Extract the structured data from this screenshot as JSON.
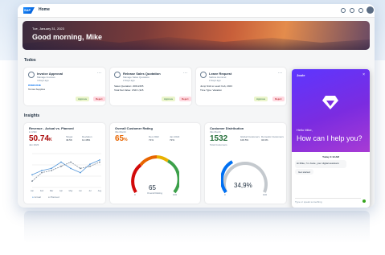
{
  "header": {
    "logo_text": "SAP",
    "title": "Home"
  },
  "hero": {
    "date": "Tue, January 31, 2023",
    "greeting": "Good morning, Mike"
  },
  "sections": {
    "todos": "Todos",
    "insights": "Insights"
  },
  "todos": [
    {
      "title": "Invoice Approval",
      "sub1": "Manage Invoices",
      "sub2": "4 days ago",
      "tag": "OVER-DUE",
      "line1": "Tomsa Supplies",
      "approve": "Approve",
      "reject": "Reject"
    },
    {
      "title": "Release Sales Quotation",
      "sub1": "Manage Sales Quotation",
      "sub2": "2 days ago",
      "line1": "Sales Quotation: 20012465",
      "line2": "Total Net Value: USD 1,915",
      "approve": "Approve",
      "reject": "Reject"
    },
    {
      "title": "Leave Request",
      "sub1": "Sabine Hummel",
      "sub2": "2 days ago",
      "line1": "Jump Sick to Lead: Feb, 2023",
      "line2": "Time Type: Vacation",
      "approve": "Approve",
      "reject": "Reject"
    }
  ],
  "insights": {
    "revenue": {
      "title": "Revenue - Actual vs. Planned",
      "sub": "in USD",
      "value": "50.74",
      "unit": "K",
      "target_label": "Target",
      "target": "49.5K",
      "deviation_label": "Deviation",
      "deviation": "12.48%",
      "period": "Jan 2023",
      "legend_actual": "Actual",
      "legend_planned": "Planned"
    },
    "rating": {
      "title": "Overall Customer Rating",
      "sub": "this Month",
      "value": "65",
      "unit": "%",
      "label1": "Dec 2022",
      "val1": "71%",
      "label2": "Jan 2022",
      "val2": "72%",
      "gauge_value": "65",
      "gauge_label": "Overall Rating",
      "gauge_min": "0",
      "gauge_max": "100",
      "level": 0.65
    },
    "distribution": {
      "title": "Customer Distribution",
      "sub": "this Month",
      "value": "1532",
      "unit": "",
      "label1": "Global Customers",
      "val1": "100.5%",
      "label2": "Domestic Customers",
      "val2": "34.9%",
      "period": "Total Customers",
      "donut_value": "34,9%",
      "level": 0.349,
      "gauge_min": "0",
      "gauge_max": "100"
    }
  },
  "chat": {
    "name": "Joule",
    "close": "×",
    "hello": "Hello Mike,",
    "help": "How can I help you?",
    "today": "Today 4:19 AM",
    "msg": "Hi Mike, I'm Joule, your digital assistant.",
    "bubble": "Get started",
    "input_placeholder": "Type or speak something"
  },
  "colors": {
    "accent": "#0070f2",
    "chat_top": "#5d36ff",
    "chat_bottom": "#a83bd4",
    "approve": "#256f3a",
    "reject": "#aa0808",
    "kpi_green": "#256f3a",
    "kpi_orange": "#e76500"
  },
  "chart_data": [
    {
      "type": "line",
      "x": [
        "Jan",
        "Feb",
        "Mar",
        "Apr",
        "May",
        "Jun",
        "Jul",
        "Aug"
      ],
      "series": [
        {
          "name": "Actual",
          "values": [
            38,
            40,
            41,
            44,
            41,
            39,
            43,
            45
          ]
        },
        {
          "name": "Planned",
          "values": [
            35,
            39,
            40,
            42,
            44,
            41,
            42,
            44
          ]
        }
      ]
    }
  ]
}
